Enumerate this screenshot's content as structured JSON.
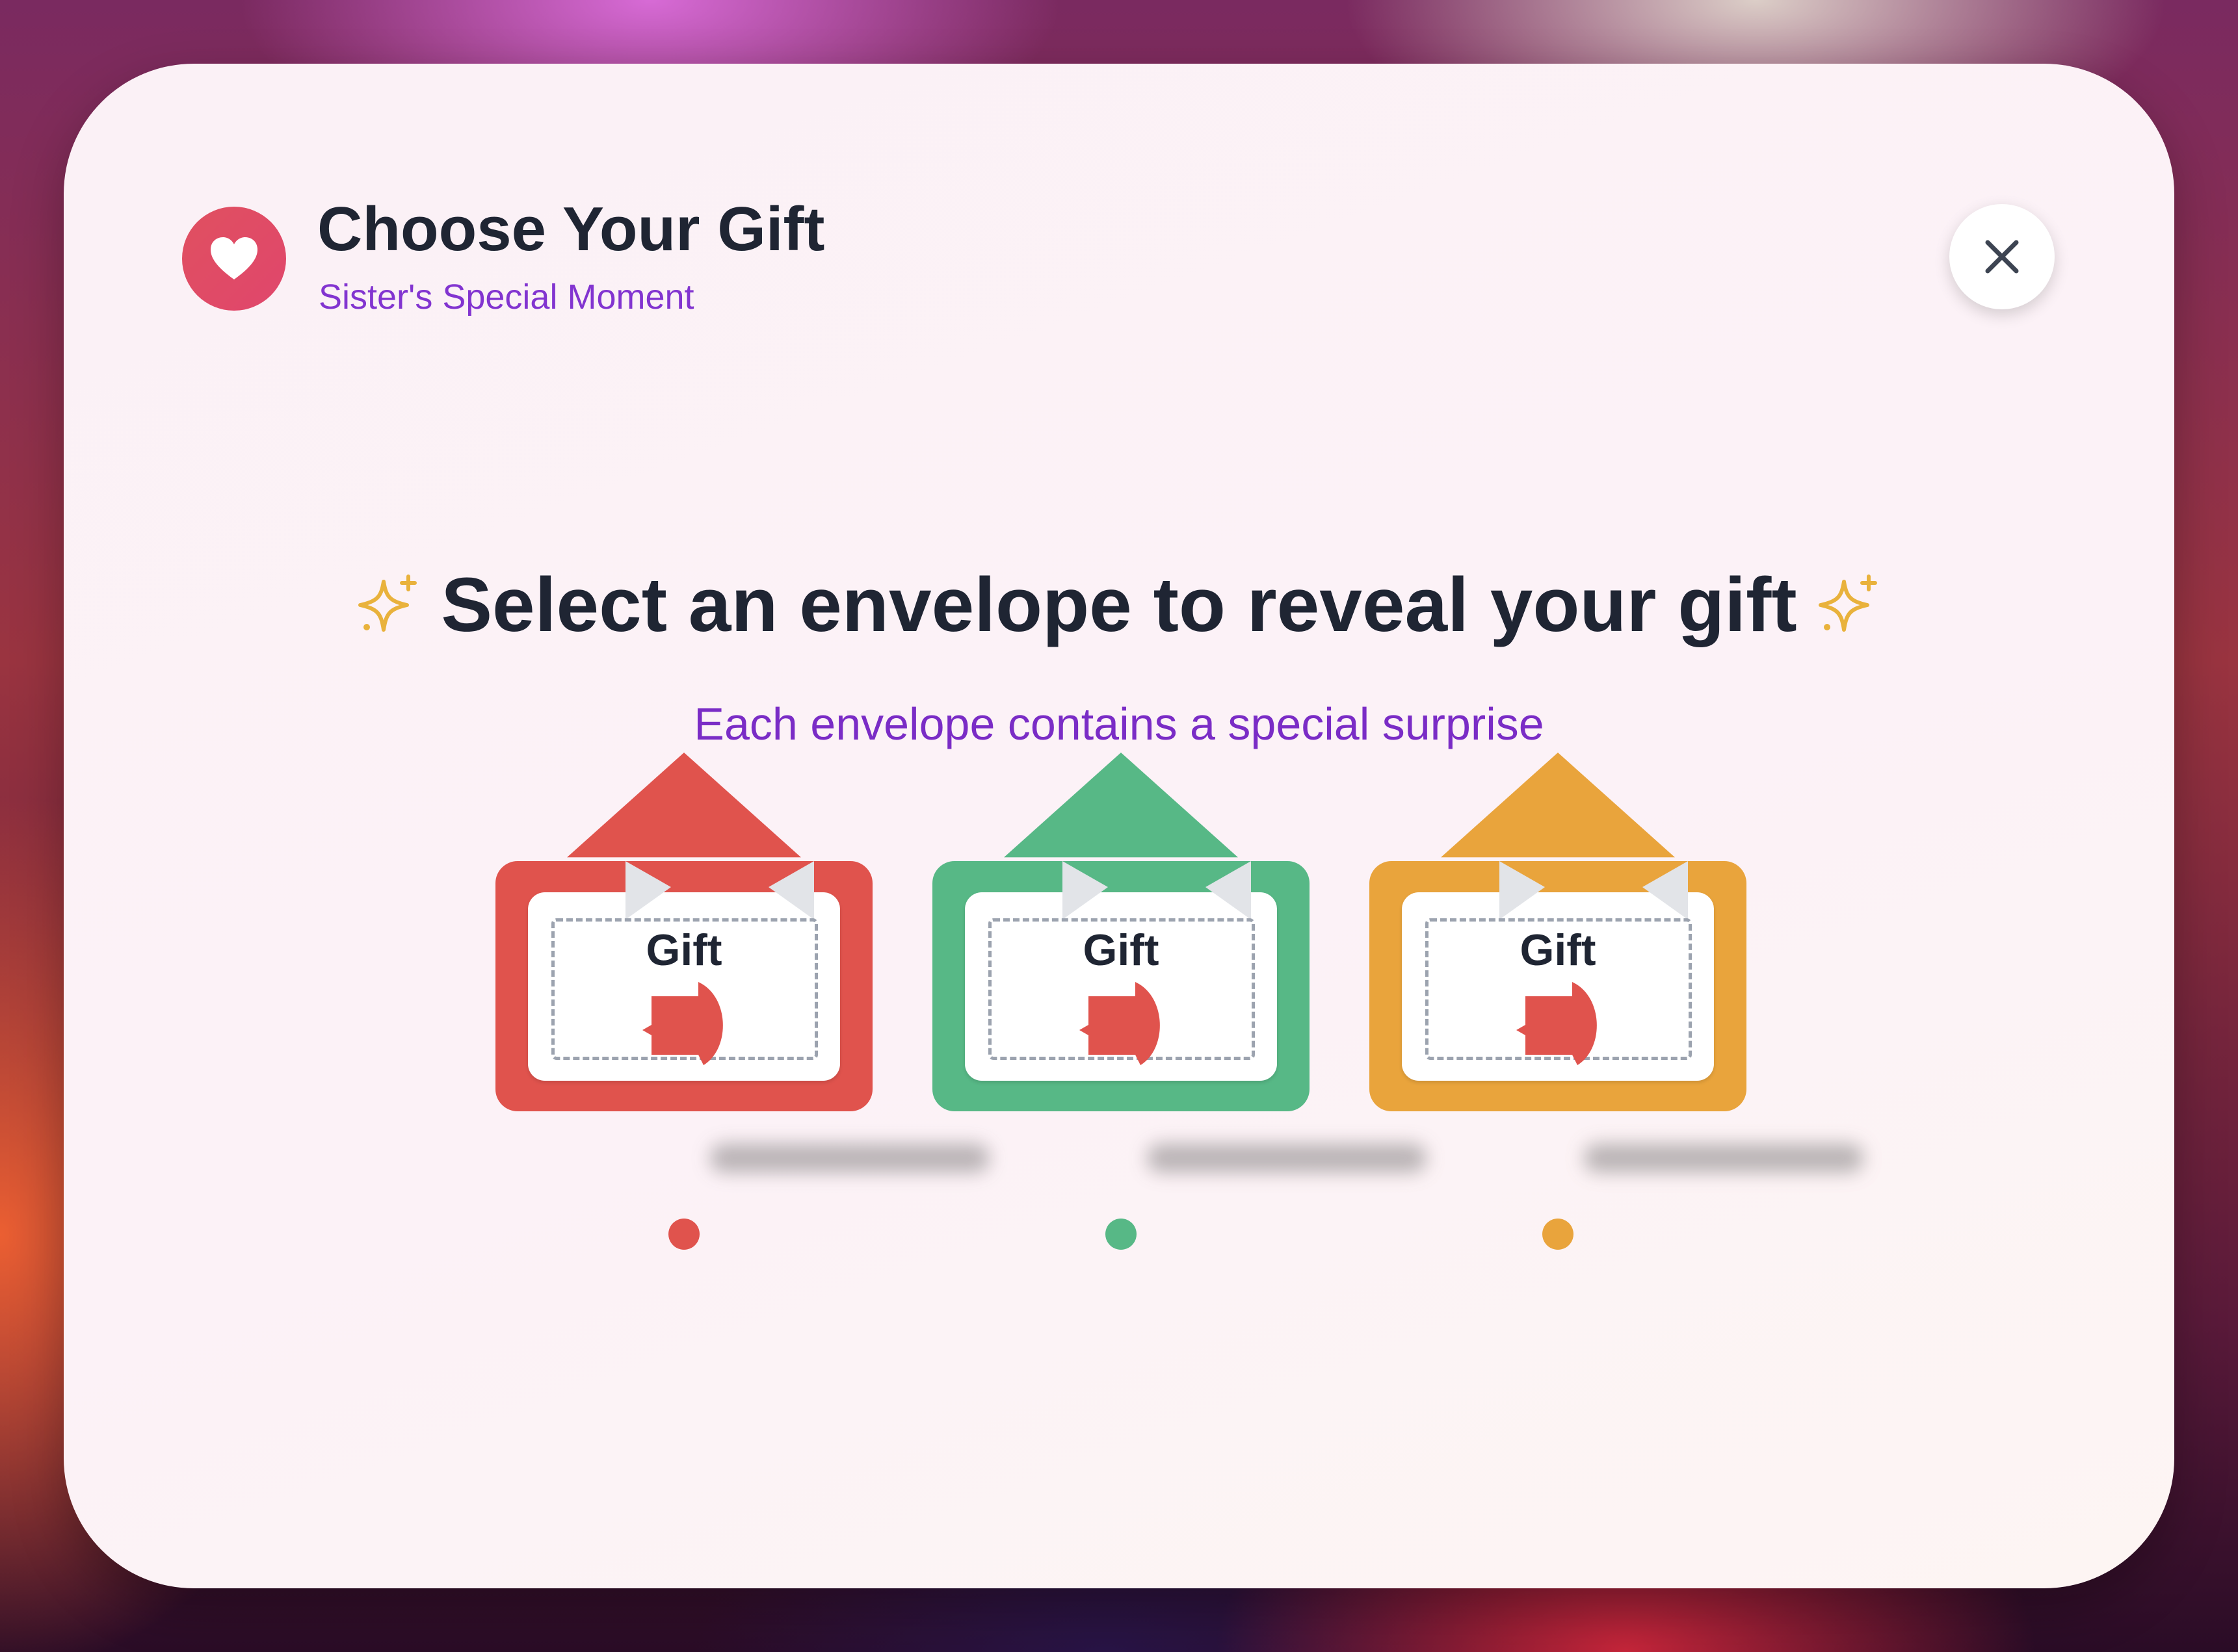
{
  "header": {
    "title": "Choose Your Gift",
    "subtitle": "Sister's Special Moment",
    "icon": "heart-icon",
    "icon_color": "#e0466c"
  },
  "close": {
    "icon": "close-icon"
  },
  "main": {
    "headline": "Select an envelope to reveal your gift",
    "headline_icon": "sparkles-icon",
    "subline": "Each envelope contains a special surprise"
  },
  "envelopes": [
    {
      "label": "Gift",
      "color": "#e0534d",
      "seal_color": "#e0534d"
    },
    {
      "label": "Gift",
      "color": "#57b886",
      "seal_color": "#e0534d"
    },
    {
      "label": "Gift",
      "color": "#e9a43c",
      "seal_color": "#e0534d"
    }
  ],
  "colors": {
    "title": "#1f2533",
    "subtitle": "#8234d0",
    "sparkle": "#e9b23c"
  }
}
